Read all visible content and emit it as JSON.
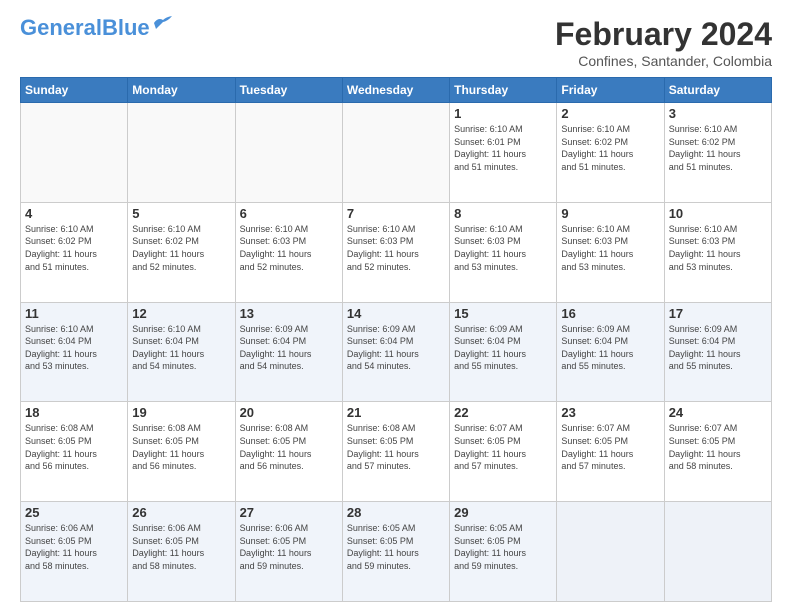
{
  "header": {
    "logo_general": "General",
    "logo_blue": "Blue",
    "month_title": "February 2024",
    "location": "Confines, Santander, Colombia"
  },
  "weekdays": [
    "Sunday",
    "Monday",
    "Tuesday",
    "Wednesday",
    "Thursday",
    "Friday",
    "Saturday"
  ],
  "weeks": [
    {
      "alt": false,
      "days": [
        {
          "num": "",
          "info": ""
        },
        {
          "num": "",
          "info": ""
        },
        {
          "num": "",
          "info": ""
        },
        {
          "num": "",
          "info": ""
        },
        {
          "num": "1",
          "info": "Sunrise: 6:10 AM\nSunset: 6:01 PM\nDaylight: 11 hours\nand 51 minutes."
        },
        {
          "num": "2",
          "info": "Sunrise: 6:10 AM\nSunset: 6:02 PM\nDaylight: 11 hours\nand 51 minutes."
        },
        {
          "num": "3",
          "info": "Sunrise: 6:10 AM\nSunset: 6:02 PM\nDaylight: 11 hours\nand 51 minutes."
        }
      ]
    },
    {
      "alt": false,
      "days": [
        {
          "num": "4",
          "info": "Sunrise: 6:10 AM\nSunset: 6:02 PM\nDaylight: 11 hours\nand 51 minutes."
        },
        {
          "num": "5",
          "info": "Sunrise: 6:10 AM\nSunset: 6:02 PM\nDaylight: 11 hours\nand 52 minutes."
        },
        {
          "num": "6",
          "info": "Sunrise: 6:10 AM\nSunset: 6:03 PM\nDaylight: 11 hours\nand 52 minutes."
        },
        {
          "num": "7",
          "info": "Sunrise: 6:10 AM\nSunset: 6:03 PM\nDaylight: 11 hours\nand 52 minutes."
        },
        {
          "num": "8",
          "info": "Sunrise: 6:10 AM\nSunset: 6:03 PM\nDaylight: 11 hours\nand 53 minutes."
        },
        {
          "num": "9",
          "info": "Sunrise: 6:10 AM\nSunset: 6:03 PM\nDaylight: 11 hours\nand 53 minutes."
        },
        {
          "num": "10",
          "info": "Sunrise: 6:10 AM\nSunset: 6:03 PM\nDaylight: 11 hours\nand 53 minutes."
        }
      ]
    },
    {
      "alt": true,
      "days": [
        {
          "num": "11",
          "info": "Sunrise: 6:10 AM\nSunset: 6:04 PM\nDaylight: 11 hours\nand 53 minutes."
        },
        {
          "num": "12",
          "info": "Sunrise: 6:10 AM\nSunset: 6:04 PM\nDaylight: 11 hours\nand 54 minutes."
        },
        {
          "num": "13",
          "info": "Sunrise: 6:09 AM\nSunset: 6:04 PM\nDaylight: 11 hours\nand 54 minutes."
        },
        {
          "num": "14",
          "info": "Sunrise: 6:09 AM\nSunset: 6:04 PM\nDaylight: 11 hours\nand 54 minutes."
        },
        {
          "num": "15",
          "info": "Sunrise: 6:09 AM\nSunset: 6:04 PM\nDaylight: 11 hours\nand 55 minutes."
        },
        {
          "num": "16",
          "info": "Sunrise: 6:09 AM\nSunset: 6:04 PM\nDaylight: 11 hours\nand 55 minutes."
        },
        {
          "num": "17",
          "info": "Sunrise: 6:09 AM\nSunset: 6:04 PM\nDaylight: 11 hours\nand 55 minutes."
        }
      ]
    },
    {
      "alt": false,
      "days": [
        {
          "num": "18",
          "info": "Sunrise: 6:08 AM\nSunset: 6:05 PM\nDaylight: 11 hours\nand 56 minutes."
        },
        {
          "num": "19",
          "info": "Sunrise: 6:08 AM\nSunset: 6:05 PM\nDaylight: 11 hours\nand 56 minutes."
        },
        {
          "num": "20",
          "info": "Sunrise: 6:08 AM\nSunset: 6:05 PM\nDaylight: 11 hours\nand 56 minutes."
        },
        {
          "num": "21",
          "info": "Sunrise: 6:08 AM\nSunset: 6:05 PM\nDaylight: 11 hours\nand 57 minutes."
        },
        {
          "num": "22",
          "info": "Sunrise: 6:07 AM\nSunset: 6:05 PM\nDaylight: 11 hours\nand 57 minutes."
        },
        {
          "num": "23",
          "info": "Sunrise: 6:07 AM\nSunset: 6:05 PM\nDaylight: 11 hours\nand 57 minutes."
        },
        {
          "num": "24",
          "info": "Sunrise: 6:07 AM\nSunset: 6:05 PM\nDaylight: 11 hours\nand 58 minutes."
        }
      ]
    },
    {
      "alt": true,
      "days": [
        {
          "num": "25",
          "info": "Sunrise: 6:06 AM\nSunset: 6:05 PM\nDaylight: 11 hours\nand 58 minutes."
        },
        {
          "num": "26",
          "info": "Sunrise: 6:06 AM\nSunset: 6:05 PM\nDaylight: 11 hours\nand 58 minutes."
        },
        {
          "num": "27",
          "info": "Sunrise: 6:06 AM\nSunset: 6:05 PM\nDaylight: 11 hours\nand 59 minutes."
        },
        {
          "num": "28",
          "info": "Sunrise: 6:05 AM\nSunset: 6:05 PM\nDaylight: 11 hours\nand 59 minutes."
        },
        {
          "num": "29",
          "info": "Sunrise: 6:05 AM\nSunset: 6:05 PM\nDaylight: 11 hours\nand 59 minutes."
        },
        {
          "num": "",
          "info": ""
        },
        {
          "num": "",
          "info": ""
        }
      ]
    }
  ]
}
